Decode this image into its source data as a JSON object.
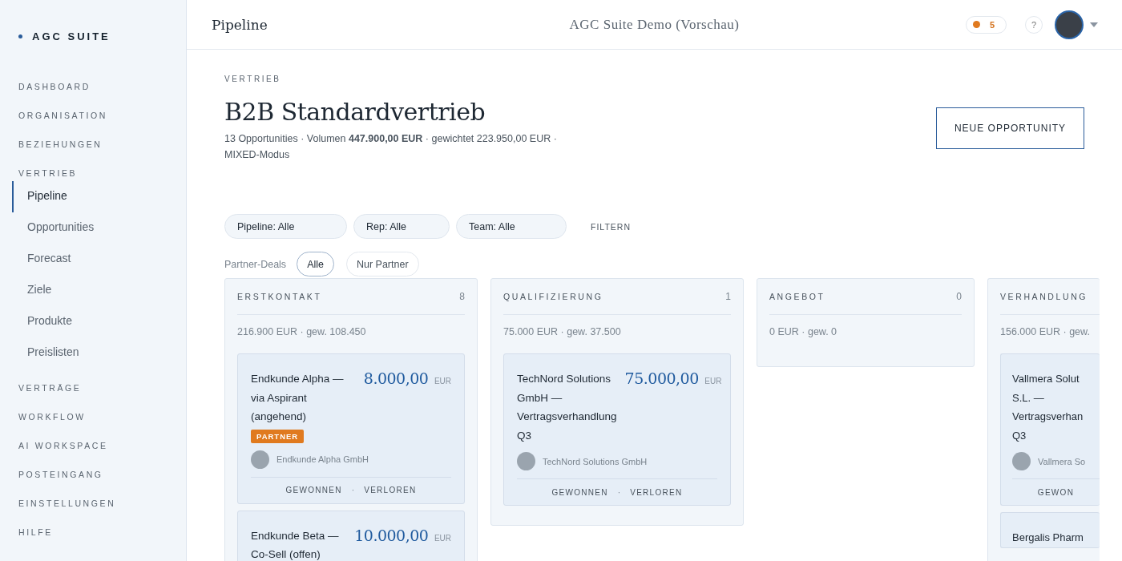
{
  "brand": {
    "name": "AGC SUITE"
  },
  "nav": [
    {
      "label": "DASHBOARD",
      "kind": "section",
      "selected": false
    },
    {
      "label": "ORGANISATION",
      "kind": "section",
      "selected": false
    },
    {
      "label": "BEZIEHUNGEN",
      "kind": "section",
      "selected": false
    },
    {
      "label": "VERTRIEB",
      "kind": "section",
      "selected": false,
      "children": [
        {
          "label": "Pipeline",
          "selected": true
        },
        {
          "label": "Opportunities",
          "selected": false
        },
        {
          "label": "Forecast",
          "selected": false
        },
        {
          "label": "Ziele",
          "selected": false
        },
        {
          "label": "Produkte",
          "selected": false
        },
        {
          "label": "Preislisten",
          "selected": false
        }
      ]
    },
    {
      "label": "VERTRÄGE",
      "kind": "section",
      "selected": false
    },
    {
      "label": "WORKFLOW",
      "kind": "section",
      "selected": false
    },
    {
      "label": "AI WORKSPACE",
      "kind": "section",
      "selected": false
    },
    {
      "label": "POSTEINGANG",
      "kind": "section",
      "selected": false
    },
    {
      "label": "EINSTELLUNGEN",
      "kind": "section",
      "selected": false
    },
    {
      "label": "HILFE",
      "kind": "section",
      "selected": false
    }
  ],
  "topbar": {
    "title": "Pipeline",
    "center": "AGC Suite Demo (Vorschau)",
    "notifications": "5",
    "help": "?"
  },
  "header": {
    "eyebrow": "VERTRIEB",
    "title": "B2B Standardvertrieb",
    "summary": "13 Opportunities · Volumen **447.900,00 EUR** · gewichtet 223.950,00 EUR · MIXED-Modus",
    "action": "NEUE OPPORTUNITY"
  },
  "filters": [
    {
      "label": "Pipeline: Alle"
    },
    {
      "label": "Rep: Alle"
    },
    {
      "label": "Team: Alle"
    }
  ],
  "filter_button": "FILTERN",
  "partner_filter": {
    "label": "Partner-Deals",
    "options": [
      {
        "label": "Alle",
        "selected": true
      },
      {
        "label": "Nur Partner",
        "selected": false
      }
    ]
  },
  "columns": [
    {
      "name": "ERSTKONTAKT",
      "count": "8",
      "totals": "216.900 EUR · gew. 108.450",
      "cards": [
        {
          "title": "Endkunde Alpha — via Aspirant (angehend)",
          "amount": "8.000,00",
          "currency": "EUR",
          "badge": "PARTNER",
          "company": "Endkunde Alpha GmbH",
          "won": "GEWONNEN",
          "sep": "·",
          "lost": "VERLOREN"
        },
        {
          "title": "Endkunde Beta — Co-Sell (offen)",
          "amount": "10.000,00",
          "currency": "EUR"
        }
      ]
    },
    {
      "name": "QUALIFIZIERUNG",
      "count": "1",
      "totals": "75.000 EUR · gew. 37.500",
      "cards": [
        {
          "title": "TechNord Solutions GmbH — Vertragsverhandlung Q3",
          "amount": "75.000,00",
          "currency": "EUR",
          "company": "TechNord Solutions GmbH",
          "won": "GEWONNEN",
          "sep": "·",
          "lost": "VERLOREN"
        }
      ]
    },
    {
      "name": "ANGEBOT",
      "count": "0",
      "totals": "0 EUR · gew. 0"
    },
    {
      "name": "VERHANDLUNG",
      "totals": "156.000 EUR · gew.",
      "cards": [
        {
          "title": "Vallmera Solut S.L. — Vertragsverhan Q3",
          "company": "Vallmera So",
          "won": "GEWON"
        },
        {
          "title": "Bergalis Pharm"
        }
      ]
    }
  ]
}
